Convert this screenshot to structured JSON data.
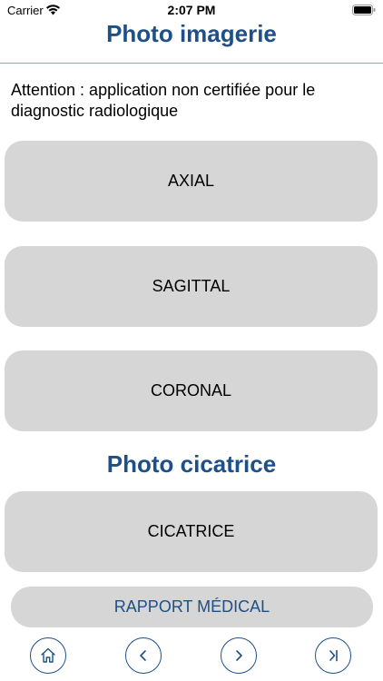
{
  "status_bar": {
    "carrier": "Carrier",
    "time": "2:07 PM",
    "icons": [
      "wifi-icon",
      "battery-icon"
    ]
  },
  "header": {
    "title": "Photo imagerie"
  },
  "warning_text": "Attention : application non certifiée pour le diagnostic radiologique",
  "buttons": {
    "axial": "AXIAL",
    "sagittal": "SAGITTAL",
    "coronal": "CORONAL"
  },
  "scar_section": {
    "title": "Photo cicatrice",
    "button": "CICATRICE"
  },
  "report_button": "RAPPORT MÉDICAL",
  "toolbar": {
    "icons": [
      "home-icon",
      "chevron-left-icon",
      "chevron-right-icon",
      "skip-to-end-icon"
    ]
  },
  "colors": {
    "accent": "#1e4f86",
    "button_bg": "#d6d6d6"
  }
}
